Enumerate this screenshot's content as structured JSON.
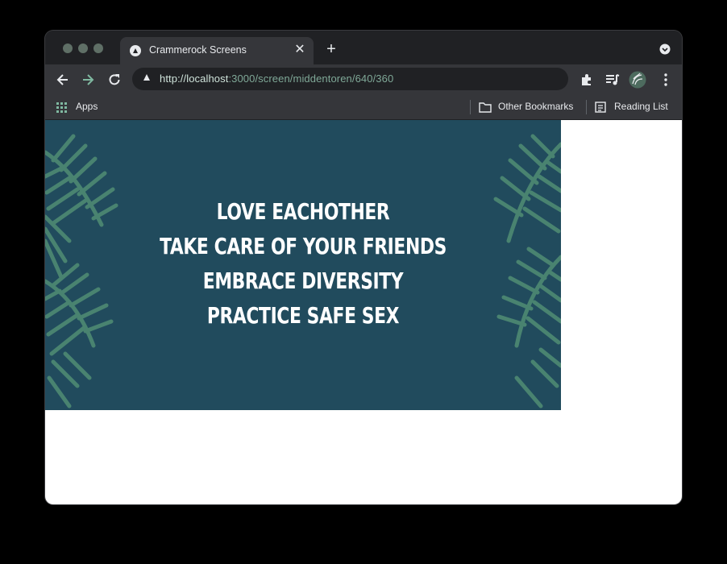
{
  "browser": {
    "tab": {
      "title": "Crammerock Screens"
    },
    "address": {
      "scheme_host": "http://localhost",
      "port_path": ":3000/screen/middentoren/640/360"
    },
    "bookmarks": {
      "apps": "Apps",
      "other": "Other Bookmarks",
      "reading": "Reading List"
    }
  },
  "screen": {
    "background": "#214b5d",
    "leaf_color": "#4e8a73",
    "lines": [
      "LOVE EACHOTHER",
      "TAKE CARE OF YOUR FRIENDS",
      "EMBRACE DIVERSITY",
      "PRACTICE SAFE SEX"
    ]
  }
}
